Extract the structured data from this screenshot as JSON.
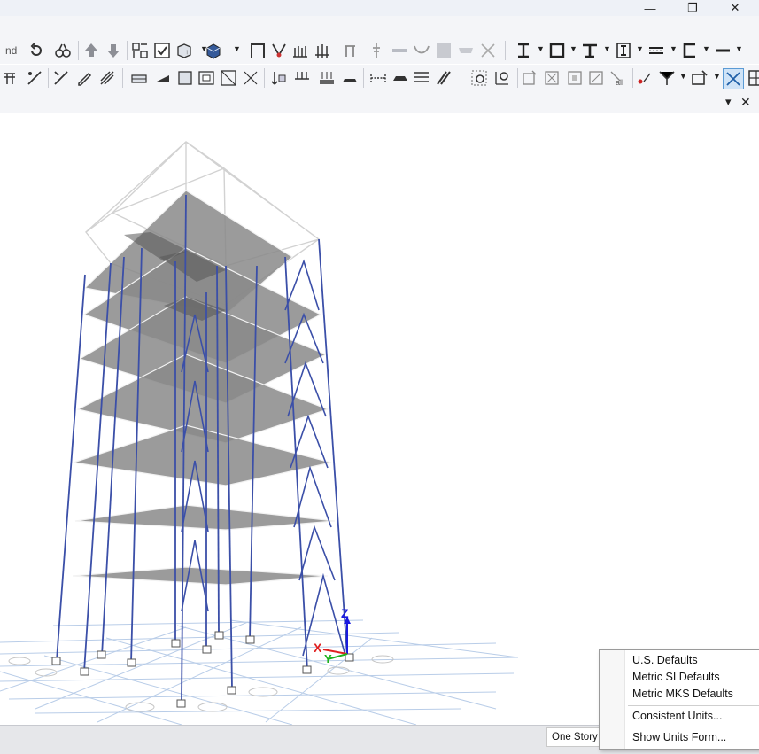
{
  "window": {
    "minimize_glyph": "—",
    "restore_glyph": "❐",
    "close_glyph": "✕"
  },
  "toolbar1": {
    "cut_text": "nd"
  },
  "panel": {
    "dropdown_glyph": "▾",
    "close_glyph": "✕"
  },
  "axes": {
    "x": "X",
    "y": "Y",
    "z": "Z"
  },
  "status": {
    "one_story": "One Story"
  },
  "units_menu": {
    "items": [
      "U.S. Defaults",
      "Metric SI Defaults",
      "Metric MKS Defaults",
      "Consistent Units...",
      "Show Units Form..."
    ]
  },
  "colors": {
    "frame": "#3b4fa8",
    "slab": "#8a8a8a",
    "grid": "#b9cde8",
    "axis_x": "#e02020",
    "axis_y": "#1db21d",
    "axis_z": "#1a1adf"
  }
}
